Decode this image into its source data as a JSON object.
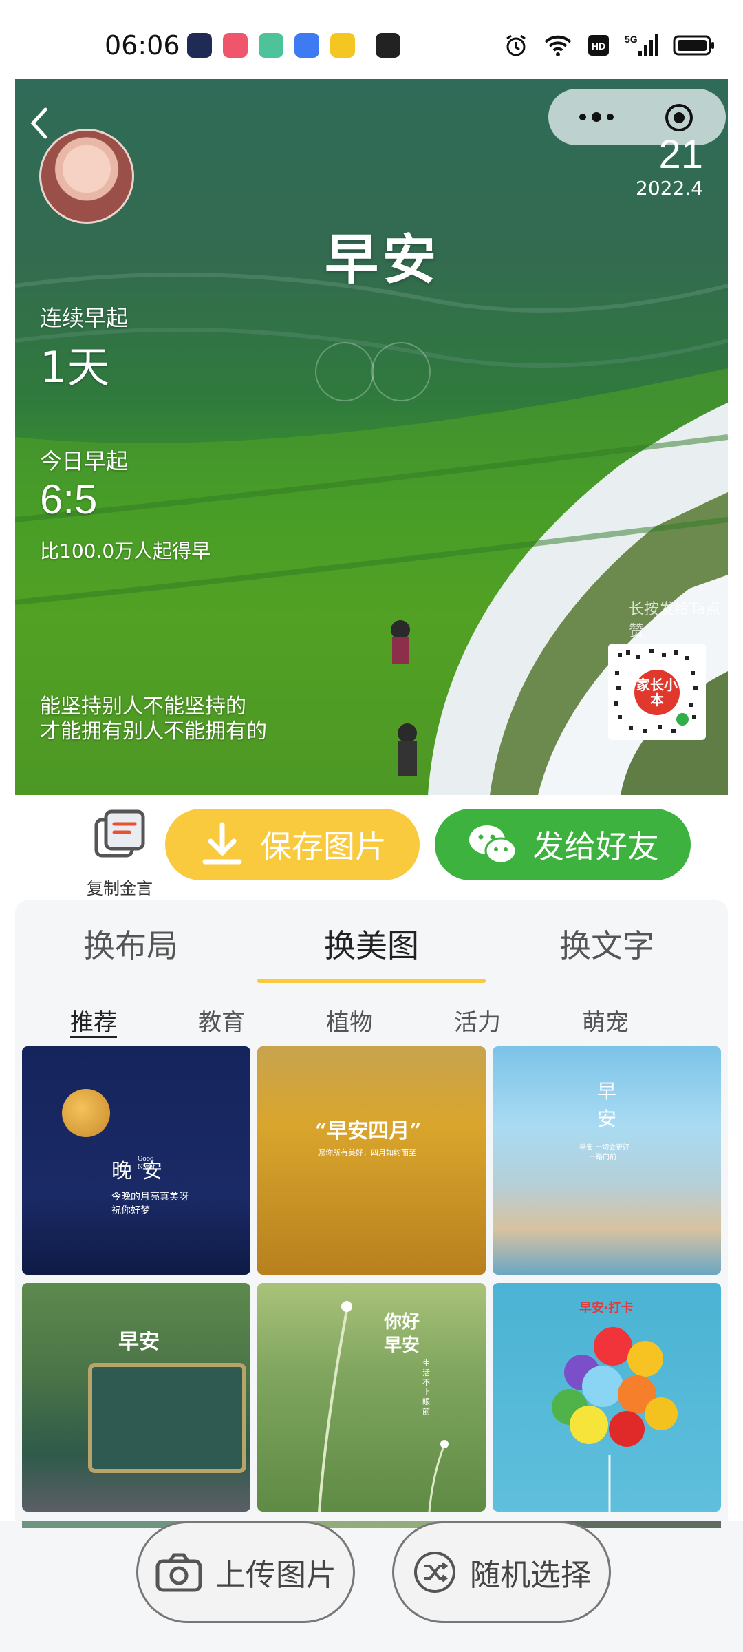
{
  "status_bar": {
    "time": "06:06",
    "icons": [
      "alarm-icon",
      "wifi-icon",
      "hd-icon",
      "5g-signal-icon",
      "battery-icon"
    ]
  },
  "card": {
    "day": "21",
    "year_month": "2022.4",
    "title": "早安",
    "streak_label": "连续早起",
    "streak_value": "1天",
    "today_label": "今日早起",
    "today_time": "6:5",
    "compare_text": "比100.0万人起得早",
    "quote_line1": "能坚持别人不能坚持的",
    "quote_line2": "才能拥有别人不能拥有的",
    "send_hint": "长按发给Ta点赞",
    "qr_brand": "家长小本"
  },
  "actions": {
    "copy_label": "复制金言",
    "save_label": "保存图片",
    "send_label": "发给好友"
  },
  "panel": {
    "tabs": [
      "换布局",
      "换美图",
      "换文字"
    ],
    "active_tab": 1,
    "categories": [
      "推荐",
      "教育",
      "植物",
      "活力",
      "萌宠"
    ],
    "tiles": [
      {
        "theme": "night",
        "main": "晚安",
        "small": "Good Night",
        "caption1": "今晚的月亮真美呀",
        "caption2": "祝你好梦"
      },
      {
        "theme": "wheat",
        "main": "“早安四月”",
        "caption1": "愿你所有美好，四月如约而至"
      },
      {
        "theme": "town",
        "main": "早安",
        "caption1": "早安·一切会更好",
        "caption2": "一路向前"
      },
      {
        "theme": "tram",
        "main": "早安"
      },
      {
        "theme": "flower",
        "main": "你好早安",
        "caption1": "生活不止眼前"
      },
      {
        "theme": "balloon",
        "main": "早安·打卡"
      }
    ]
  },
  "bottom": {
    "upload_label": "上传图片",
    "random_label": "随机选择"
  }
}
